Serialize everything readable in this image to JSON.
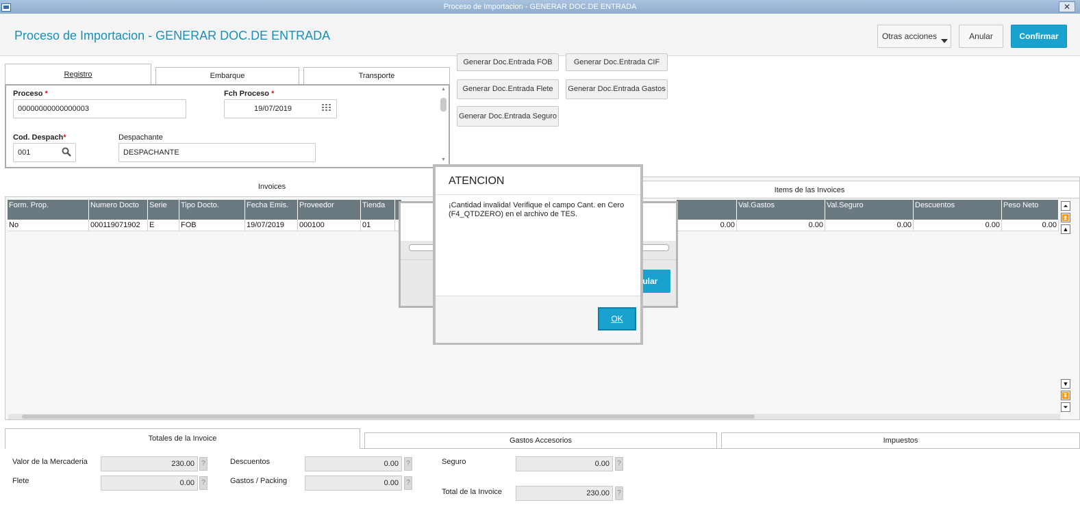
{
  "window": {
    "title": "Proceso de Importacion - GENERAR DOC.DE ENTRADA"
  },
  "header": {
    "title": "Proceso de Importacion - GENERAR DOC.DE ENTRADA",
    "actions": {
      "other": "Otras acciones",
      "cancel": "Anular",
      "confirm": "Confirmar"
    }
  },
  "form_tabs": {
    "registro": "Registro",
    "embarque": "Embarque",
    "transporte": "Transporte"
  },
  "form": {
    "proceso_label": "Proceso",
    "proceso_value": "00000000000000003",
    "fch_label": "Fch Proceso",
    "fch_value": "19/07/2019",
    "cod_label": "Cod. Despach",
    "cod_value": "001",
    "desp_label": "Despachante",
    "desp_value": "DESPACHANTE",
    "required_mark": "*"
  },
  "gen_buttons": {
    "fob": "Generar Doc.Entrada FOB",
    "cif": "Generar Doc.Entrada CIF",
    "flete": "Generar Doc.Entrada Flete",
    "gastos": "Generar Doc.Entrada Gastos",
    "seguro": "Generar Doc.Entrada Seguro"
  },
  "invoices": {
    "title": "Invoices",
    "columns": [
      "Form. Prop.",
      "Numero Docto",
      "Serie",
      "Tipo Docto.",
      "Fecha Emis.",
      "Proveedor",
      "Tienda"
    ],
    "row": [
      "No",
      "000119071902",
      "E",
      "FOB",
      "19/07/2019",
      "000100",
      "01"
    ]
  },
  "items": {
    "title": "Items de las Invoices",
    "columns": [
      "Val.Gastos",
      "Val.Seguro",
      "Descuentos",
      "Peso Neto"
    ],
    "row": [
      "0.00",
      "0.00",
      "0.00",
      "0.00",
      "0.00"
    ]
  },
  "bottom_tabs": {
    "totales": "Totales de la Invoice",
    "gastos": "Gastos Accesorios",
    "impuestos": "Impuestos"
  },
  "totals": {
    "valor_label": "Valor de la Mercaderia",
    "valor": "230.00",
    "flete_label": "Flete",
    "flete": "0.00",
    "desc_label": "Descuentos",
    "desc": "0.00",
    "gastos_label": "Gastos / Packing",
    "gastos": "0.00",
    "seguro_label": "Seguro",
    "seguro": "0.00",
    "total_label": "Total de la Invoice",
    "total": "230.00",
    "help": "?"
  },
  "progress_dialog": {
    "cancel_partial": "nular"
  },
  "dialog": {
    "title": "ATENCION",
    "message": "¡Cantidad invalida! Verifique el campo Cant. en Cero (F4_QTDZERO) en el archivo de TES.",
    "ok": "OK"
  },
  "icons": {
    "calendar": "calendar-icon",
    "search": "search-icon",
    "close": "close-icon"
  },
  "colors": {
    "accent": "#1aa2cf",
    "grid_header": "#6b7980",
    "title_text": "#1a8fb8"
  }
}
